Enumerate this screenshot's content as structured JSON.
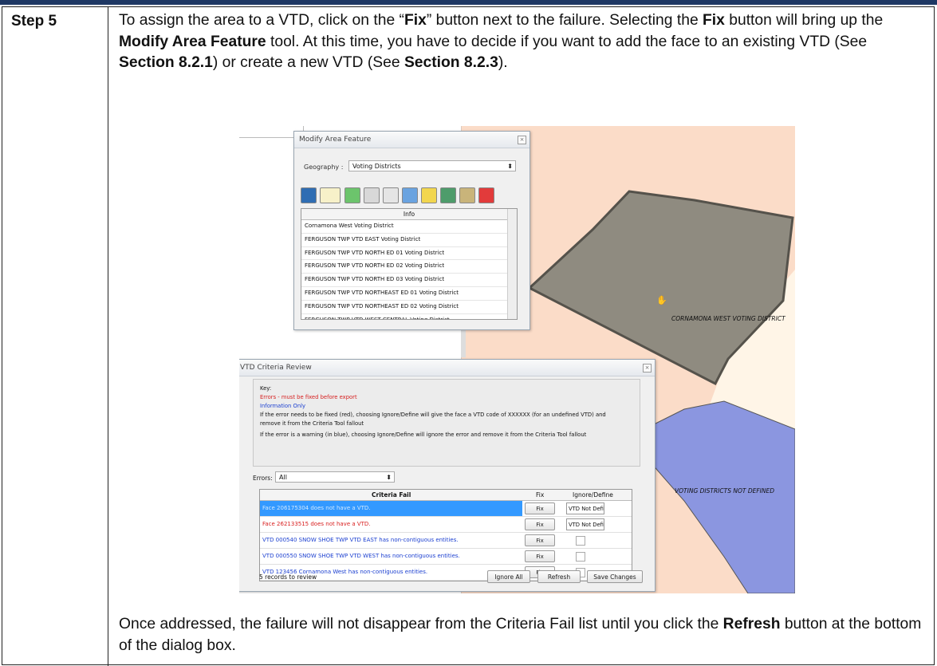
{
  "step_label": "Step 5",
  "intro": {
    "t1": "To assign the area to a VTD, click on the “",
    "b1": "Fix",
    "t2": "” button next to the failure. Selecting the ",
    "b2": "Fix",
    "t3": " button will bring up the ",
    "b3": "Modify Area Feature",
    "t4": " tool. At this time, you have to decide if you want to add the face to an existing VTD (See ",
    "b4": "Section 8.2.1",
    "t5": ") or create a new VTD (See ",
    "b5": "Section 8.2.3",
    "t6": ")."
  },
  "outro": {
    "t1": "Once addressed, the failure will not disappear from the Criteria Fail list until you click the ",
    "b1": "Refresh",
    "t2": " button at the bottom of the dialog box."
  },
  "map": {
    "label_district": "CORNAMONA WEST VOTING DISTRICT",
    "label_undefined": "VOTING DISTRICTS NOT DEFINED",
    "colors": {
      "background": "#fbdcc8",
      "selected": "#8f8b80",
      "undefined": "#8b96e0",
      "pale": "#fff5e7"
    }
  },
  "modify_dialog": {
    "title": "Modify Area Feature",
    "geography_label": "Geography :",
    "geography_value": "Voting Districts",
    "list_header": "Info",
    "items": [
      "Cornamona West Voting District",
      "FERGUSON TWP VTD EAST Voting District",
      "FERGUSON TWP VTD NORTH ED 01 Voting District",
      "FERGUSON TWP VTD NORTH ED 02 Voting District",
      "FERGUSON TWP VTD NORTH ED 03 Voting District",
      "FERGUSON TWP VTD NORTHEAST ED 01 Voting District",
      "FERGUSON TWP VTD NORTHEAST ED 02 Voting District",
      "FERGUSON TWP VTD WEST CENTRAL Voting District"
    ]
  },
  "criteria_dialog": {
    "title": "VTD Criteria Review",
    "key_label": "Key:",
    "key_error": "Errors - must be fixed before export",
    "key_info": "Information Only",
    "key_note1": "If the error needs to be fixed (red), choosing Ignore/Define will give the face a VTD code of XXXXXX (for an undefined VTD) and remove it from the Criteria Tool fallout",
    "key_note2": "If the error is a warning (in blue), choosing Ignore/Define will ignore the error and remove it from the Criteria Tool fallout",
    "errors_label": "Errors:",
    "errors_value": "All",
    "col_fail": "Criteria Fail",
    "col_fix": "Fix",
    "col_ignore": "Ignore/Define",
    "rows": [
      {
        "text": "Face 206175304 does not have a VTD.",
        "fix": "Fix",
        "ignore": "VTD Not Defined"
      },
      {
        "text": "Face 262133515 does not have a VTD.",
        "fix": "Fix",
        "ignore": "VTD Not Defined"
      },
      {
        "text": "VTD 000540 SNOW SHOE TWP VTD EAST has non-contiguous entities.",
        "fix": "Fix",
        "ignore": ""
      },
      {
        "text": "VTD 000550 SNOW SHOE TWP VTD WEST has non-contiguous entities.",
        "fix": "Fix",
        "ignore": ""
      },
      {
        "text": "VTD 123456 Cornamona West has non-contiguous entities.",
        "fix": "Fix",
        "ignore": ""
      }
    ],
    "status": "5 records to review",
    "btn_ignore_all": "Ignore All",
    "btn_refresh": "Refresh",
    "btn_save": "Save Changes"
  }
}
